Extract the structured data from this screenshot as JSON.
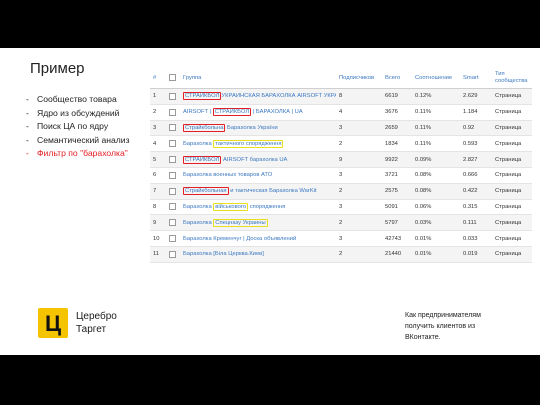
{
  "title": "Пример",
  "bullets": [
    {
      "dash": "-",
      "text": "Сообщество товара"
    },
    {
      "dash": "-",
      "text": "Ядро из обсуждений"
    },
    {
      "dash": "-",
      "text": "Поиск ЦА по ядру"
    },
    {
      "dash": "-",
      "text": "Семантический анализ"
    },
    {
      "dash": "-",
      "text": "Фильтр по \"барахолка\""
    }
  ],
  "table": {
    "headers": [
      "#",
      "",
      "Группа",
      "Подписчиков",
      "Всего",
      "Соотношение",
      "Smart",
      "Тип сообщества"
    ],
    "rows": [
      {
        "n": "1",
        "group": [
          [
            "СТРАЙКБОЛ",
            "red"
          ],
          [
            "УКРАИНСКАЯ БАРАХОЛКА AIRSOFT УКРАИНА",
            ""
          ]
        ],
        "subs": "8",
        "total": "6619",
        "ratio": "0.12%",
        "smart": "2.629",
        "type": "Страница"
      },
      {
        "n": "2",
        "group": [
          [
            "AIRSOFT | ",
            ""
          ],
          [
            "СТРАЙКБОЛ",
            "red"
          ],
          [
            " | БАРАХОЛКА | UA",
            ""
          ]
        ],
        "subs": "4",
        "total": "3676",
        "ratio": "0.11%",
        "smart": "1.184",
        "type": "Страница"
      },
      {
        "n": "3",
        "group": [
          [
            "Страйкбольна",
            "red"
          ],
          [
            " Барахолка України",
            ""
          ]
        ],
        "subs": "3",
        "total": "2659",
        "ratio": "0.11%",
        "smart": "0.92",
        "type": "Страница"
      },
      {
        "n": "4",
        "group": [
          [
            "Барахолка ",
            ""
          ],
          [
            "тактичного спорядження",
            "yel"
          ]
        ],
        "subs": "2",
        "total": "1834",
        "ratio": "0.11%",
        "smart": "0.593",
        "type": "Страница"
      },
      {
        "n": "5",
        "group": [
          [
            "СТРАЙКБОЛ",
            "red"
          ],
          [
            " AIRSOFT барахолка UA",
            ""
          ]
        ],
        "subs": "9",
        "total": "9922",
        "ratio": "0.09%",
        "smart": "2.827",
        "type": "Страница"
      },
      {
        "n": "6",
        "group": [
          [
            "Барахолка военных товаров АТО",
            ""
          ]
        ],
        "subs": "3",
        "total": "3721",
        "ratio": "0.08%",
        "smart": "0.666",
        "type": "Страница"
      },
      {
        "n": "7",
        "group": [
          [
            "Страйкбольная",
            "red"
          ],
          [
            " и тактическая Барахолка WarKit",
            ""
          ]
        ],
        "subs": "2",
        "total": "2575",
        "ratio": "0.08%",
        "smart": "0.422",
        "type": "Страница"
      },
      {
        "n": "8",
        "group": [
          [
            "Барахолка ",
            ""
          ],
          [
            "військового",
            "yel"
          ],
          [
            " спорядження",
            ""
          ]
        ],
        "subs": "3",
        "total": "5091",
        "ratio": "0.06%",
        "smart": "0.315",
        "type": "Страница"
      },
      {
        "n": "9",
        "group": [
          [
            "Барахолка ",
            ""
          ],
          [
            "Спецназу Украины",
            "yel"
          ]
        ],
        "subs": "2",
        "total": "5797",
        "ratio": "0.03%",
        "smart": "0.111",
        "type": "Страница"
      },
      {
        "n": "10",
        "group": [
          [
            "Барахолка Кременчуг | Доска объявлений",
            ""
          ]
        ],
        "subs": "3",
        "total": "42743",
        "ratio": "0.01%",
        "smart": "0.033",
        "type": "Страница"
      },
      {
        "n": "11",
        "group": [
          [
            "Барахолка [Біла Церква.Киев]",
            ""
          ]
        ],
        "subs": "2",
        "total": "21440",
        "ratio": "0.01%",
        "smart": "0.019",
        "type": "Страница"
      }
    ]
  },
  "brand": {
    "line1": "Церебро",
    "line2": "Таргет",
    "logo_color": "#f5c400",
    "logo_letter": "Ц"
  },
  "note": {
    "line1": "Как предпринимателям",
    "line2": "получить клиентов из",
    "line3": "ВКонтакте."
  }
}
